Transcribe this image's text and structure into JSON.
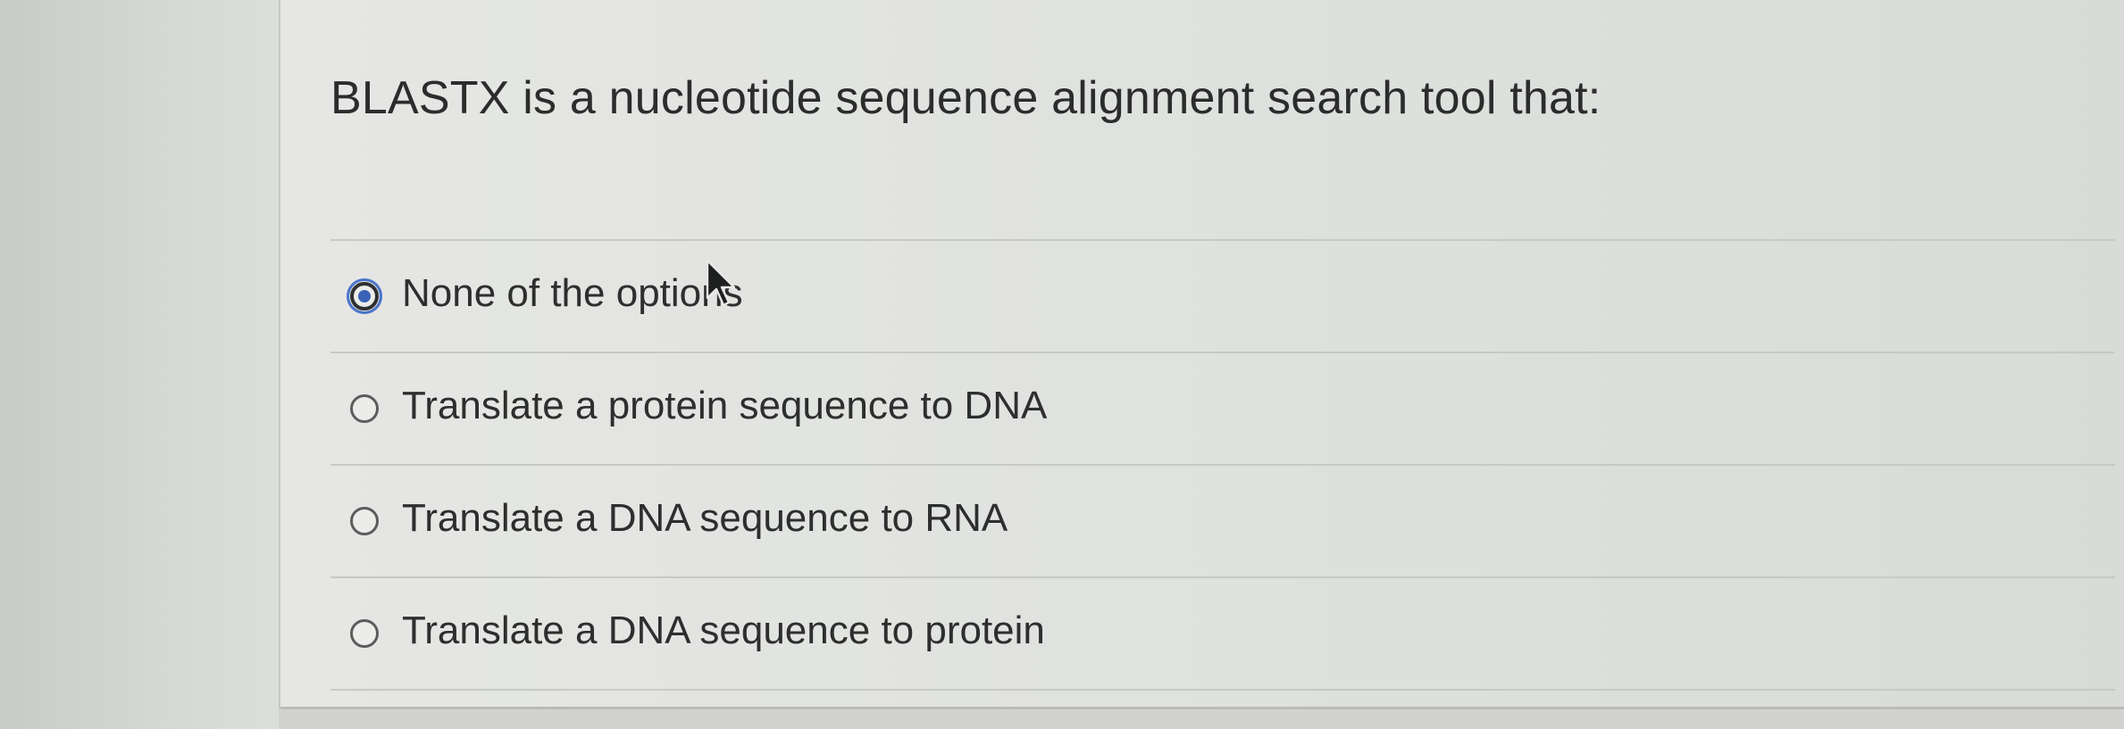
{
  "question": {
    "text": "BLASTX is a nucleotide sequence alignment search tool that:"
  },
  "options": [
    {
      "label": "None of the options",
      "selected": true
    },
    {
      "label": "Translate a protein sequence to DNA",
      "selected": false
    },
    {
      "label": "Translate a DNA sequence to RNA",
      "selected": false
    },
    {
      "label": "Translate a DNA sequence to protein",
      "selected": false
    }
  ],
  "colors": {
    "radio_selected": "#3a63b7",
    "text": "#2d2e2e"
  },
  "icons": {
    "cursor": "mouse-pointer-icon"
  }
}
